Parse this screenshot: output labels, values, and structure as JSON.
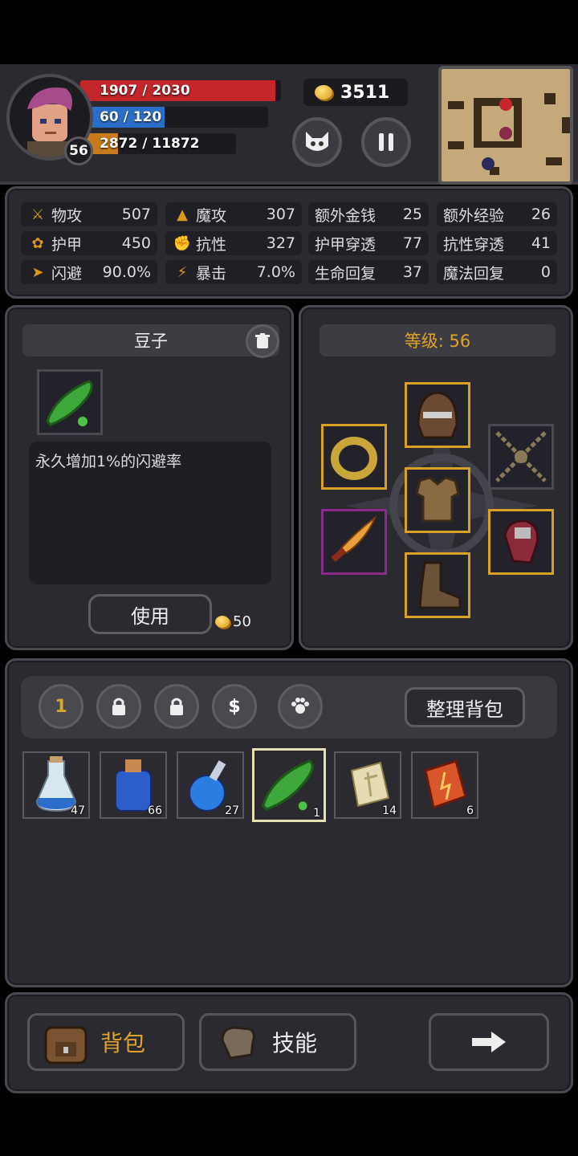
{
  "player": {
    "hp_text": "1907 / 2030",
    "mp_text": "60 / 120",
    "xp_text": "2872 / 11872",
    "level": "56",
    "hp_fraction": 0.939,
    "mp_fraction": 0.5,
    "xp_fraction": 0.242
  },
  "gold": "3511",
  "stats": [
    {
      "label": "物攻",
      "value": "507",
      "icon": "sword-icon"
    },
    {
      "label": "魔攻",
      "value": "307",
      "icon": "wizard-hat-icon"
    },
    {
      "label": "额外金钱",
      "value": "25"
    },
    {
      "label": "额外经验",
      "value": "26"
    },
    {
      "label": "护甲",
      "value": "450",
      "icon": "paw-icon"
    },
    {
      "label": "抗性",
      "value": "327",
      "icon": "muscle-icon"
    },
    {
      "label": "护甲穿透",
      "value": "77"
    },
    {
      "label": "抗性穿透",
      "value": "41"
    },
    {
      "label": "闪避",
      "value": "90.0%",
      "icon": "running-icon"
    },
    {
      "label": "暴击",
      "value": "7.0%",
      "icon": "lightning-icon"
    },
    {
      "label": "生命回复",
      "value": "37"
    },
    {
      "label": "魔法回复",
      "value": "0"
    }
  ],
  "item": {
    "name": "豆子",
    "description": "永久增加1%的闪避率",
    "use_label": "使用",
    "price": "50"
  },
  "equipment": {
    "level_text": "等级: 56"
  },
  "inventory": {
    "tab_number": "1",
    "sort_label": "整理背包",
    "items": [
      {
        "name": "potion-vial",
        "qty": "47"
      },
      {
        "name": "potion-jar",
        "qty": "66"
      },
      {
        "name": "potion-flask",
        "qty": "27"
      },
      {
        "name": "pea-pod",
        "qty": "1"
      },
      {
        "name": "rune-stone-light",
        "qty": "14"
      },
      {
        "name": "rune-stone-fire",
        "qty": "6"
      }
    ]
  },
  "nav": {
    "bag_label": "背包",
    "skills_label": "技能"
  },
  "colors": {
    "hp": "#c4262b",
    "mp": "#2b6ec9",
    "xp": "#c97a1c",
    "accent": "#e0a32a"
  }
}
